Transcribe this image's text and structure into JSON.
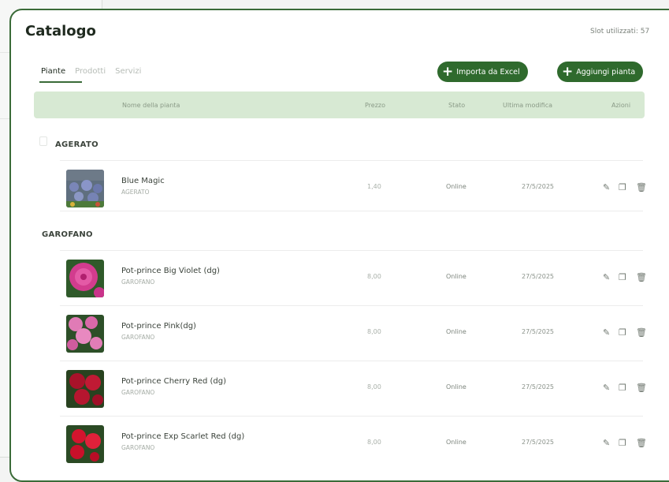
{
  "catalog": {
    "title": "Catalogo",
    "slot_label": "Slot utilizzati: 57"
  },
  "tabs": [
    {
      "label": "Piante",
      "active": true
    },
    {
      "label": "Prodotti",
      "active": false
    },
    {
      "label": "Servizi",
      "active": false
    }
  ],
  "buttons": {
    "import_label": "Importa da Excel",
    "add_label": "Aggiungi pianta"
  },
  "table": {
    "columns": [
      "Nome della pianta",
      "Prezzo",
      "Stato",
      "Ultima modifica",
      "Azioni"
    ]
  },
  "groups": [
    {
      "name": "AGERATO",
      "rows": [
        {
          "name": "Blue Magic",
          "category": "AGERATO",
          "price": "1,40",
          "state": "Online",
          "date": "27/5/2025"
        }
      ]
    },
    {
      "name": "GAROFANO",
      "rows": [
        {
          "name": "Pot-prince  Big Violet (dg)",
          "category": "GAROFANO",
          "price": "8,00",
          "state": "Online",
          "date": "27/5/2025"
        },
        {
          "name": "Pot-prince  Pink(dg)",
          "category": "GAROFANO",
          "price": "8,00",
          "state": "Online",
          "date": "27/5/2025"
        },
        {
          "name": "Pot-prince Cherry Red (dg)",
          "category": "GAROFANO",
          "price": "8,00",
          "state": "Online",
          "date": "27/5/2025"
        },
        {
          "name": "Pot-prince Exp Scarlet Red (dg)",
          "category": "GAROFANO",
          "price": "8,00",
          "state": "Online",
          "date": "27/5/2025"
        }
      ]
    }
  ],
  "colors": {
    "brand_green": "#2f6a2d",
    "header_bg": "#d7e9d3",
    "card_border": "#3a6b38"
  },
  "icons": {
    "edit": "pencil-icon",
    "duplicate": "copy-icon",
    "delete": "trash-icon"
  }
}
